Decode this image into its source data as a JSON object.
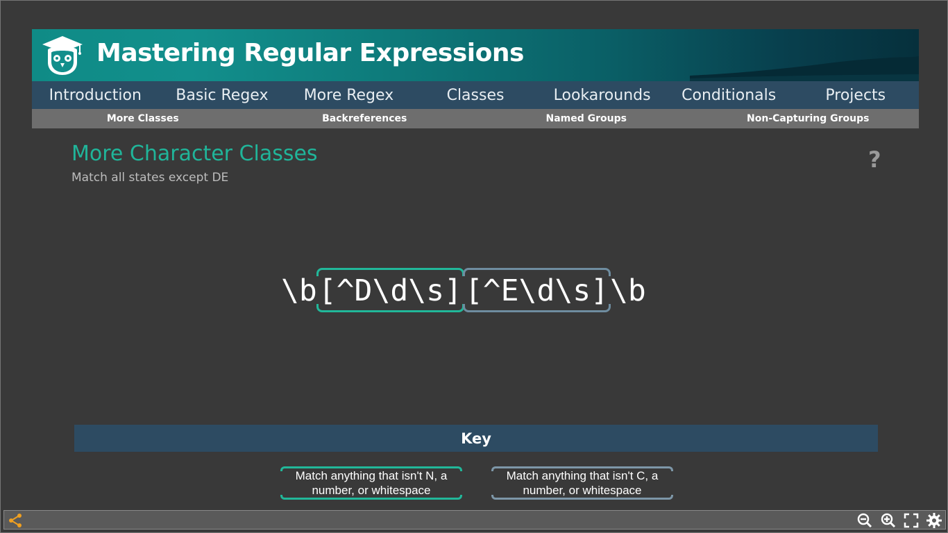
{
  "header": {
    "title": "Mastering Regular Expressions"
  },
  "nav": {
    "items": [
      "Introduction",
      "Basic Regex",
      "More Regex",
      "Classes",
      "Lookarounds",
      "Conditionals",
      "Projects"
    ]
  },
  "subnav": {
    "items": [
      "More Classes",
      "Backreferences",
      "Named Groups",
      "Non-Capturing Groups"
    ]
  },
  "lesson": {
    "title": "More Character Classes",
    "subtitle": "Match all states except DE",
    "help": "?"
  },
  "regex": {
    "prefix": "\\b",
    "group1": "[^D\\d\\s]",
    "group2": "[^E\\d\\s]",
    "suffix": "\\b"
  },
  "key": {
    "heading": "Key",
    "items": [
      {
        "text": "Match anything that isn't N, a number, or whitespace",
        "color": "#21b89a"
      },
      {
        "text": "Match anything that isn't C, a number, or whitespace",
        "color": "#7d97a8"
      }
    ]
  },
  "toolbar": {
    "icons": [
      "share-icon",
      "zoom-out-icon",
      "zoom-in-icon",
      "fullscreen-icon",
      "settings-icon"
    ],
    "accent": "#f0a020"
  },
  "colors": {
    "teal": "#20b59a",
    "nav": "#2d4b62",
    "subnav": "#6e6e6e",
    "background": "#393939"
  }
}
